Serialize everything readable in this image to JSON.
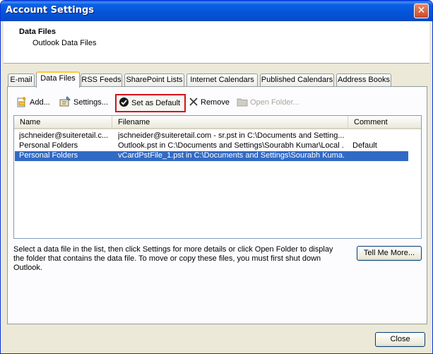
{
  "window": {
    "title": "Account Settings",
    "close_glyph": "✕"
  },
  "header": {
    "title": "Data Files",
    "subtitle": "Outlook Data Files"
  },
  "tabs": [
    {
      "label": "E-mail"
    },
    {
      "label": "Data Files"
    },
    {
      "label": "RSS Feeds"
    },
    {
      "label": "SharePoint Lists"
    },
    {
      "label": "Internet Calendars"
    },
    {
      "label": "Published Calendars"
    },
    {
      "label": "Address Books"
    }
  ],
  "toolbar": {
    "add_label": "Add...",
    "settings_label": "Settings...",
    "set_default_label": "Set as Default",
    "remove_label": "Remove",
    "open_folder_label": "Open Folder..."
  },
  "list": {
    "columns": [
      "Name",
      "Filename",
      "Comment"
    ],
    "rows": [
      {
        "name": "jschneider@suiteretail.c...",
        "filename": "jschneider@suiteretail.com - sr.pst in C:\\Documents and Setting...",
        "comment": ""
      },
      {
        "name": "Personal Folders",
        "filename": "Outlook.pst in C:\\Documents and Settings\\Sourabh Kumar\\Local ...",
        "comment": "Default"
      },
      {
        "name": "Personal Folders",
        "filename": "vCardPstFile_1.pst in C:\\Documents and Settings\\Sourabh Kuma...",
        "comment": ""
      }
    ]
  },
  "help_text": "Select a data file in the list, then click Settings for more details or click Open Folder to display the folder that contains the data file. To move or copy these files, you must first shut down Outlook.",
  "tell_me_more_label": "Tell Me More...",
  "close_label": "Close",
  "colors": {
    "selection": "#316ac5",
    "highlight_border": "#d5121a",
    "titlebar": "#0556da"
  }
}
